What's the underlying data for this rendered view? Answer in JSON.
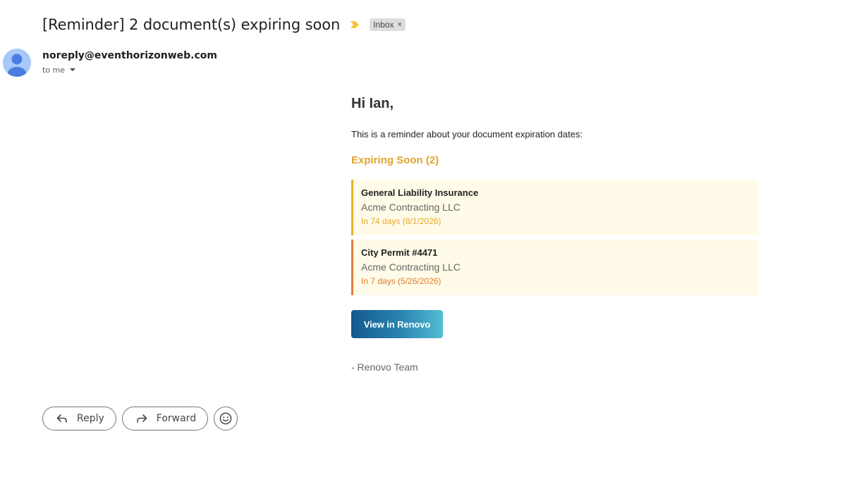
{
  "header": {
    "subject": "[Reminder] 2 document(s) expiring soon",
    "label_chip": "Inbox",
    "label_chip_close": "×",
    "importance_icon": "importance-marker-icon"
  },
  "sender": {
    "email": "noreply@eventhorizonweb.com",
    "recipient": "to me",
    "avatar_icon": "person-avatar-icon"
  },
  "email": {
    "greeting": "Hi Ian,",
    "intro": "This is a reminder about your document expiration dates:",
    "section_heading": "Expiring Soon (2)",
    "documents": [
      {
        "name": "General Liability Insurance",
        "company": "Acme Contracting LLC",
        "due": "In 74 days (8/1/2026)"
      },
      {
        "name": "City Permit #4471",
        "company": "Acme Contracting LLC",
        "due": "In 7 days (5/26/2026)"
      }
    ],
    "cta_label": "View in Renovo",
    "signature": "- Renovo Team"
  },
  "actions": {
    "reply_label": "Reply",
    "forward_label": "Forward",
    "emoji_icon": "emoji-react-icon"
  },
  "colors": {
    "accent_yellow": "#e0a52a",
    "accent_orange": "#e27c30",
    "card_background": "#fffbe8",
    "importance_marker": "#f4c542",
    "avatar_background": "#a8c7fa"
  }
}
